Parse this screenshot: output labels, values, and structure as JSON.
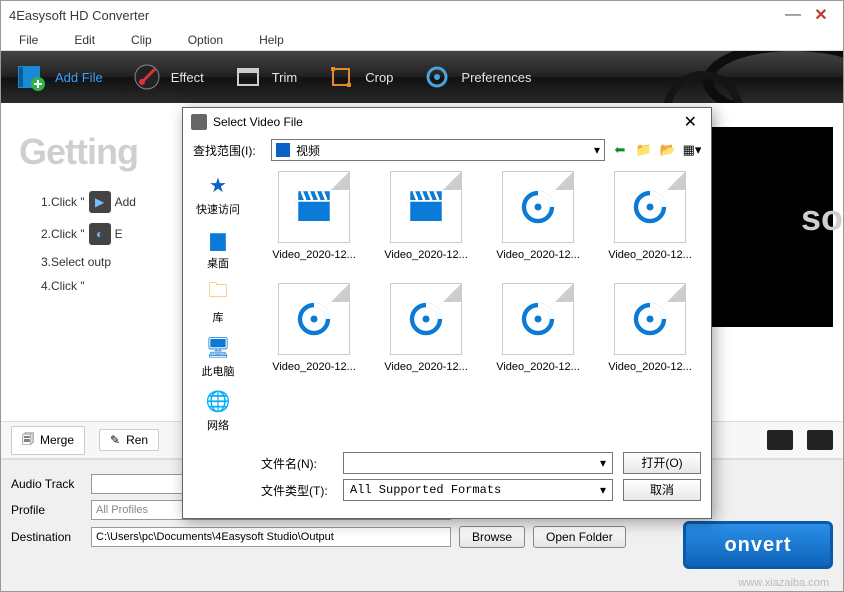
{
  "window": {
    "title": "4Easysoft HD Converter"
  },
  "menubar": {
    "items": [
      "File",
      "Edit",
      "Clip",
      "Option",
      "Help"
    ]
  },
  "toolbar": {
    "add_file": "Add File",
    "effect": "Effect",
    "trim": "Trim",
    "crop": "Crop",
    "preferences": "Preferences"
  },
  "getting": {
    "heading": "Getting",
    "soft": "soft"
  },
  "steps": {
    "s1a": "1.Click \"",
    "s1b": "Add",
    "s2a": "2.Click \"",
    "s2b": "E",
    "s3": "3.Select outp",
    "s4a": "4.Click \"",
    "s4b": ""
  },
  "merge_bar": {
    "merge": "Merge",
    "rename": "Ren"
  },
  "bottom": {
    "audio_track_label": "Audio Track",
    "profile_label": "Profile",
    "profile_value": "All Profiles",
    "destination_label": "Destination",
    "destination_value": "C:\\Users\\pc\\Documents\\4Easysoft Studio\\Output",
    "browse": "Browse",
    "open_folder": "Open Folder",
    "convert": "onvert",
    "watermark": "www.xiazaiba.com"
  },
  "dialog": {
    "title": "Select Video File",
    "lookin_label": "查找范围(I):",
    "lookin_value": "视频",
    "places": {
      "quick": "快速访问",
      "desktop": "桌面",
      "library": "库",
      "thispc": "此电脑",
      "network": "网络"
    },
    "files": [
      {
        "name": "Video_2020-12...",
        "kind": "clap"
      },
      {
        "name": "Video_2020-12...",
        "kind": "clap"
      },
      {
        "name": "Video_2020-12...",
        "kind": "disc"
      },
      {
        "name": "Video_2020-12...",
        "kind": "disc"
      },
      {
        "name": "Video_2020-12...",
        "kind": "disc"
      },
      {
        "name": "Video_2020-12...",
        "kind": "disc"
      },
      {
        "name": "Video_2020-12...",
        "kind": "disc"
      },
      {
        "name": "Video_2020-12...",
        "kind": "disc"
      }
    ],
    "filename_label": "文件名(N):",
    "filename_value": "",
    "filetype_label": "文件类型(T):",
    "filetype_value": "All Supported Formats",
    "open": "打开(O)",
    "cancel": "取消"
  }
}
